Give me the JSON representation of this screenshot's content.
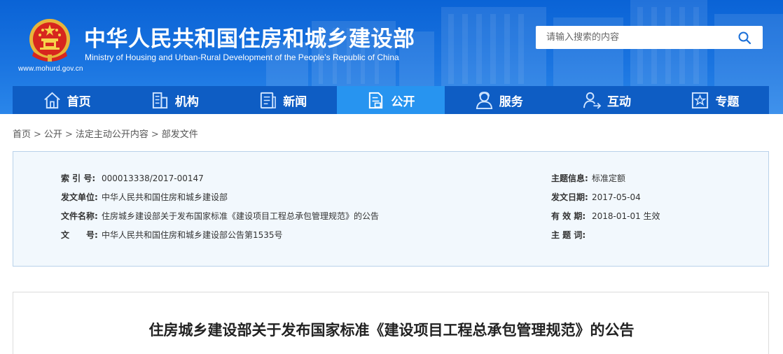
{
  "header": {
    "title": "中华人民共和国住房和城乡建设部",
    "subtitle": "Ministry of Housing and Urban-Rural Development of the People’s Republic of China",
    "url": "www.mohurd.gov.cn"
  },
  "search": {
    "placeholder": "请输入搜索的内容",
    "icon": "search-icon"
  },
  "nav": {
    "items": [
      {
        "label": "首页",
        "icon": "home-icon",
        "active": false
      },
      {
        "label": "机构",
        "icon": "building-icon",
        "active": false
      },
      {
        "label": "新闻",
        "icon": "news-icon",
        "active": false
      },
      {
        "label": "公开",
        "icon": "document-icon",
        "active": true
      },
      {
        "label": "服务",
        "icon": "service-person-icon",
        "active": false
      },
      {
        "label": "互动",
        "icon": "interaction-icon",
        "active": false
      },
      {
        "label": "专题",
        "icon": "star-icon",
        "active": false
      }
    ]
  },
  "breadcrumb": {
    "items": [
      "首页",
      "公开",
      "法定主动公开内容",
      "部发文件"
    ],
    "separator": ">"
  },
  "info": {
    "index_label": "索 引 号:",
    "index_value": "000013338/2017-00147",
    "issuer_label": "发文单位:",
    "issuer_value": "中华人民共和国住房和城乡建设部",
    "filename_label": "文件名称:",
    "filename_value": "住房城乡建设部关于发布国家标准《建设项目工程总承包管理规范》的公告",
    "docno_label": "文　　号:",
    "docno_value": "中华人民共和国住房和城乡建设部公告第1535号",
    "topic_info_label": "主题信息:",
    "topic_info_value": "标准定额",
    "date_label": "发文日期:",
    "date_value": "2017-05-04",
    "validity_label": "有 效 期:",
    "validity_value": "2018-01-01 生效",
    "keywords_label": "主 题 词:",
    "keywords_value": ""
  },
  "article": {
    "title": "住房城乡建设部关于发布国家标准《建设项目工程总承包管理规范》的公告"
  },
  "colors": {
    "header_blue": "#1a74e0",
    "nav_blue": "#0e5dc4",
    "nav_active": "#2794f0",
    "info_bg": "#f2f8fd",
    "info_border": "#b9d2ea"
  }
}
